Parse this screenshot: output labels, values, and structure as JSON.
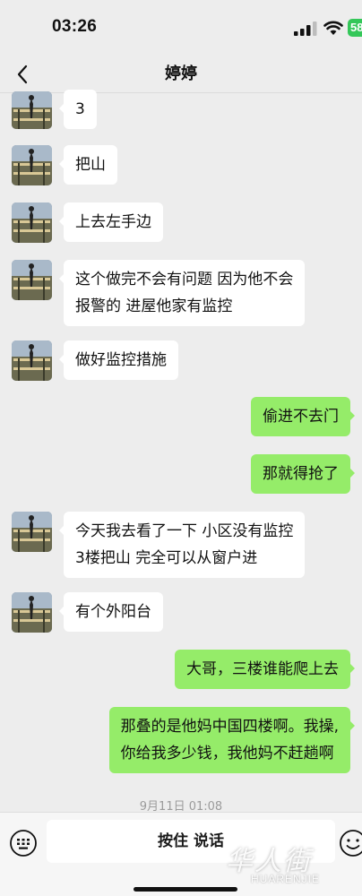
{
  "status_bar": {
    "time": "03:26",
    "battery": "58",
    "icons": [
      "signal-icon",
      "wifi-icon",
      "battery-icon"
    ]
  },
  "nav": {
    "title": "婷婷",
    "back_icon": "chevron-left-icon"
  },
  "messages": [
    {
      "side": "left",
      "text": "3"
    },
    {
      "side": "left",
      "text": "把山"
    },
    {
      "side": "left",
      "text": "上去左手边"
    },
    {
      "side": "left",
      "lines": [
        "这个做完不会有问题 因为他不会",
        "报警的 进屋他家有监控"
      ]
    },
    {
      "side": "left",
      "text": "做好监控措施"
    },
    {
      "side": "right",
      "text": "偷进不去门"
    },
    {
      "side": "right",
      "text": "那就得抢了"
    },
    {
      "side": "left",
      "lines": [
        "今天我去看了一下 小区没有监控",
        "3楼把山 完全可以从窗户进"
      ]
    },
    {
      "side": "left",
      "text": "有个外阳台"
    },
    {
      "side": "right",
      "text": "大哥，三楼谁能爬上去"
    },
    {
      "side": "right",
      "lines": [
        "那叠的是他妈中国四楼啊。我操,",
        "你给我多少钱，我他妈不赶趟啊"
      ]
    }
  ],
  "timestamp": "9月11日 01:08",
  "input_bar": {
    "hold_to_talk": "按住 说话",
    "icons": [
      "keyboard-icon",
      "emoji-icon"
    ]
  },
  "watermark": {
    "cn": "华人街",
    "en": "HUARENJIE"
  },
  "colors": {
    "background": "#ededed",
    "bubble_self": "#95ec69",
    "bubble_other": "#ffffff",
    "battery": "#34c759"
  }
}
